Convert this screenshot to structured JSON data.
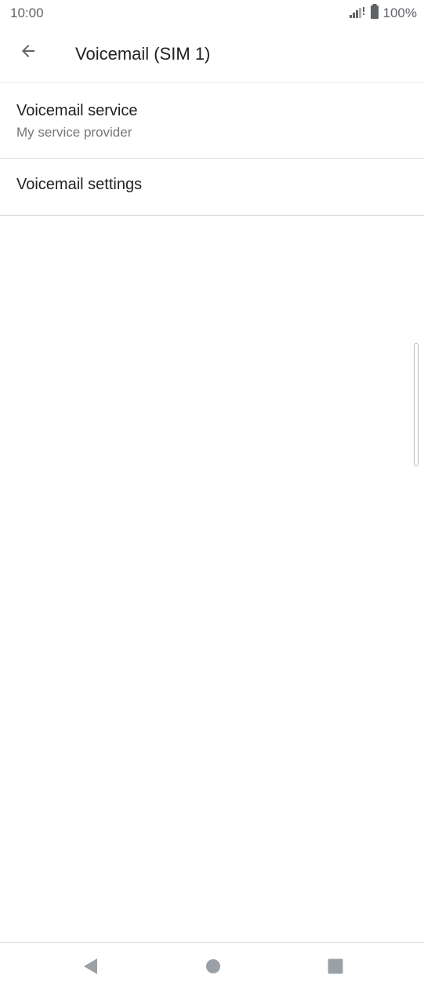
{
  "status_bar": {
    "time": "10:00",
    "battery_percent": "100%",
    "icons": [
      "signal-icon",
      "battery-icon"
    ]
  },
  "app_bar": {
    "back_icon": "arrow-left-icon",
    "title": "Voicemail (SIM 1)"
  },
  "list": {
    "items": [
      {
        "title": "Voicemail service",
        "subtitle": "My service provider"
      },
      {
        "title": "Voicemail settings"
      }
    ]
  },
  "nav_bar": {
    "icons": [
      "nav-back-icon",
      "nav-home-icon",
      "nav-recents-icon"
    ]
  },
  "colors": {
    "text_primary": "#202124",
    "text_secondary": "#757575",
    "icon_gray": "#5f6368",
    "divider": "#dadce0"
  }
}
